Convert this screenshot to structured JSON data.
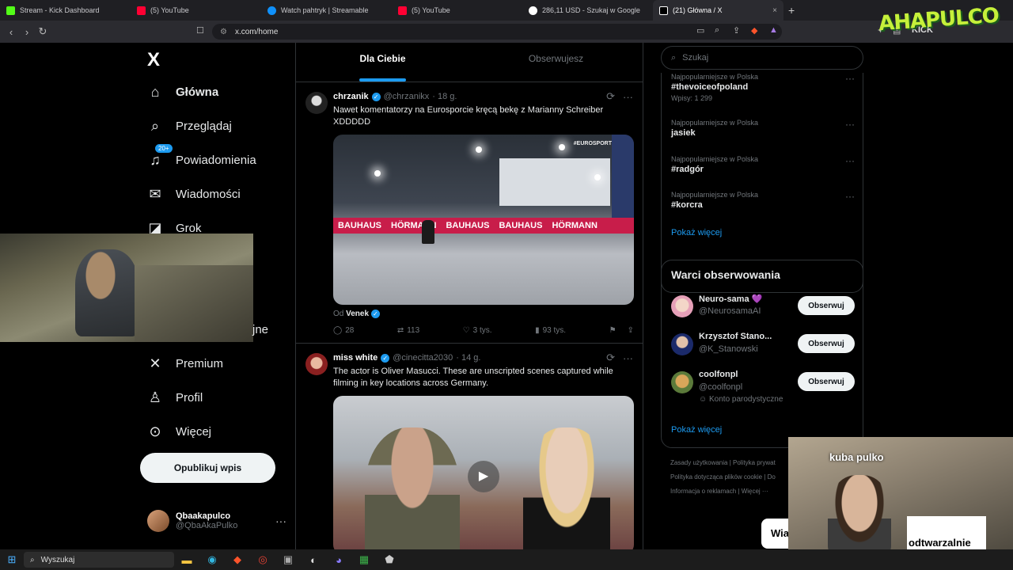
{
  "tabs": [
    {
      "title": "Stream - Kick Dashboard",
      "color": "#53fc18"
    },
    {
      "title": "(5) YouTube",
      "color": "#ff0033"
    },
    {
      "title": "Watch pahtryk | Streamable",
      "color": "#0f90fa"
    },
    {
      "title": "(5) YouTube",
      "color": "#ff0033"
    },
    {
      "title": "286,11 USD - Szukaj w Google",
      "color": "#ffffff"
    },
    {
      "title": "(21) Główna / X",
      "color": "#000000"
    }
  ],
  "browser": {
    "url": "x.com/home",
    "new_tab": "+",
    "close": "×",
    "partial_kick": "KICK"
  },
  "brand_badge": "AHAPULCO",
  "nav": {
    "logo": "X",
    "items": [
      {
        "label": "Główna",
        "icon": "home-icon"
      },
      {
        "label": "Przeglądaj",
        "icon": "search-icon"
      },
      {
        "label": "Powiadomienia",
        "icon": "bell-icon",
        "badge": "20+"
      },
      {
        "label": "Wiadomości",
        "icon": "mail-icon"
      },
      {
        "label": "Grok",
        "icon": "grok-icon"
      },
      {
        "label": "Premium",
        "icon": "x-icon"
      },
      {
        "label": "Profil",
        "icon": "person-icon"
      },
      {
        "label": "Więcej",
        "icon": "more-icon"
      }
    ],
    "hidden_suffix": "jne",
    "publish": "Opublikuj wpis",
    "account": {
      "name": "Qbaakapulco",
      "handle": "@QbaAkaPulko",
      "more": "···"
    }
  },
  "timeline": {
    "tabs": [
      {
        "label": "Dla Ciebie"
      },
      {
        "label": "Obserwujesz"
      }
    ],
    "tweets": [
      {
        "name": "chrzanik",
        "handle": "@chrzanikx",
        "time": "· 18 g.",
        "text": "Nawet komentatorzy na Eurosporcie kręcą bekę z Marianny Schreiber XDDDDD",
        "media_watermark": "#EUROSPORT",
        "banner": [
          "BAUHAUS",
          "HÖRMANN",
          "BAUHAUS",
          "BAUHAUS",
          "HÖRMANN"
        ],
        "source_prefix": "Od",
        "source_name": "Venek",
        "replies": "28",
        "reposts": "113",
        "likes": "3 tys.",
        "views": "93 tys."
      },
      {
        "name": "miss white",
        "handle": "@cinecitta2030",
        "time": "· 14 g.",
        "text": "The actor is Oliver Masucci. These are unscripted scenes captured while filming in key locations across Germany."
      }
    ]
  },
  "right": {
    "search_placeholder": "Szukaj",
    "trends": [
      {
        "context": "Najpopularniejsze w Polska",
        "title": "#thevoiceofpoland",
        "count": "Wpisy: 1 299"
      },
      {
        "context": "Najpopularniejsze w Polska",
        "title": "jasiek"
      },
      {
        "context": "Najpopularniejsze w Polska",
        "title": "#radgór"
      },
      {
        "context": "Najpopularniejsze w Polska",
        "title": "#korcra"
      }
    ],
    "show_more": "Pokaż więcej",
    "who_to_follow": {
      "title": "Warci obserwowania",
      "users": [
        {
          "name": "Neuro-sama 💜",
          "handle": "@NeurosamaAI",
          "button": "Obserwuj"
        },
        {
          "name": "Krzysztof Stano...",
          "handle": "@K_Stanowski",
          "button": "Obserwuj"
        },
        {
          "name": "coolfonpl",
          "handle": "@coolfonpl",
          "sub": "Konto parodystyczne",
          "button": "Obserwuj"
        }
      ],
      "show_more": "Pokaż więcej"
    },
    "footer": [
      "Zasady użytkowania",
      "Polityka prywat",
      "Polityka dotycząca plików cookie",
      "Do",
      "Informacja o reklamach",
      "Więcej ···"
    ]
  },
  "stream_overlay": {
    "cam_name": "kuba pulko",
    "sign_text": "odtwarzalnie",
    "stub_text": "Wia"
  },
  "taskbar": {
    "search": "Wyszukaj"
  }
}
